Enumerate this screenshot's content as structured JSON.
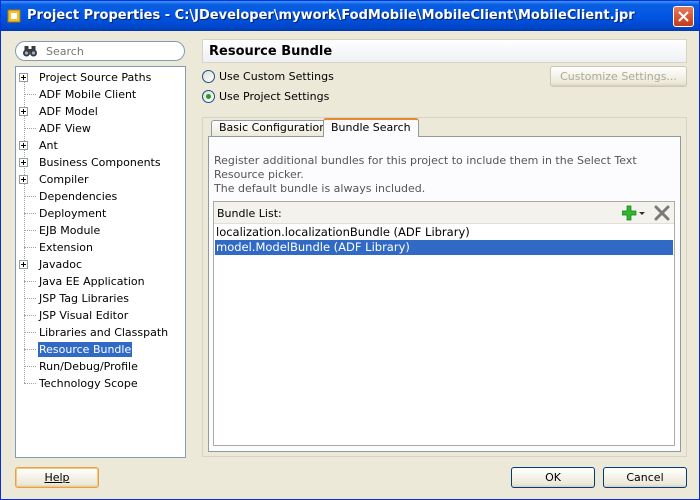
{
  "window": {
    "title": "Project Properties - C:\\JDeveloper\\mywork\\FodMobile\\MobileClient\\MobileClient.jpr"
  },
  "search": {
    "placeholder": "Search"
  },
  "tree": {
    "items": [
      {
        "label": "Project Source Paths",
        "expandable": true
      },
      {
        "label": "ADF Mobile Client",
        "expandable": false
      },
      {
        "label": "ADF Model",
        "expandable": true
      },
      {
        "label": "ADF View",
        "expandable": false
      },
      {
        "label": "Ant",
        "expandable": true
      },
      {
        "label": "Business Components",
        "expandable": true
      },
      {
        "label": "Compiler",
        "expandable": true
      },
      {
        "label": "Dependencies",
        "expandable": false
      },
      {
        "label": "Deployment",
        "expandable": false
      },
      {
        "label": "EJB Module",
        "expandable": false
      },
      {
        "label": "Extension",
        "expandable": false
      },
      {
        "label": "Javadoc",
        "expandable": true
      },
      {
        "label": "Java EE Application",
        "expandable": false
      },
      {
        "label": "JSP Tag Libraries",
        "expandable": false
      },
      {
        "label": "JSP Visual Editor",
        "expandable": false
      },
      {
        "label": "Libraries and Classpath",
        "expandable": false
      },
      {
        "label": "Resource Bundle",
        "expandable": false,
        "selected": true
      },
      {
        "label": "Run/Debug/Profile",
        "expandable": false
      },
      {
        "label": "Technology Scope",
        "expandable": false
      }
    ]
  },
  "panel": {
    "title": "Resource Bundle",
    "use_custom": "Use Custom Settings",
    "use_project": "Use Project Settings",
    "selected_setting": "project",
    "customize_button": "Customize Settings..."
  },
  "tabs": [
    {
      "label": "Basic Configuration",
      "active": false
    },
    {
      "label": "Bundle Search",
      "active": true
    }
  ],
  "bundle_search": {
    "description_line1": "Register additional bundles for this project to include them in the Select Text Resource picker.",
    "description_line2": "The default bundle is always included.",
    "list_label": "Bundle List:",
    "bundles": [
      {
        "label": "localization.localizationBundle (ADF Library)",
        "selected": false
      },
      {
        "label": "model.ModelBundle (ADF Library)",
        "selected": true
      }
    ]
  },
  "footer": {
    "help": "Help",
    "ok": "OK",
    "cancel": "Cancel"
  },
  "colors": {
    "selection": "#316ac5",
    "titlebar": "#0055e5",
    "add_icon": "#2eb82e"
  }
}
